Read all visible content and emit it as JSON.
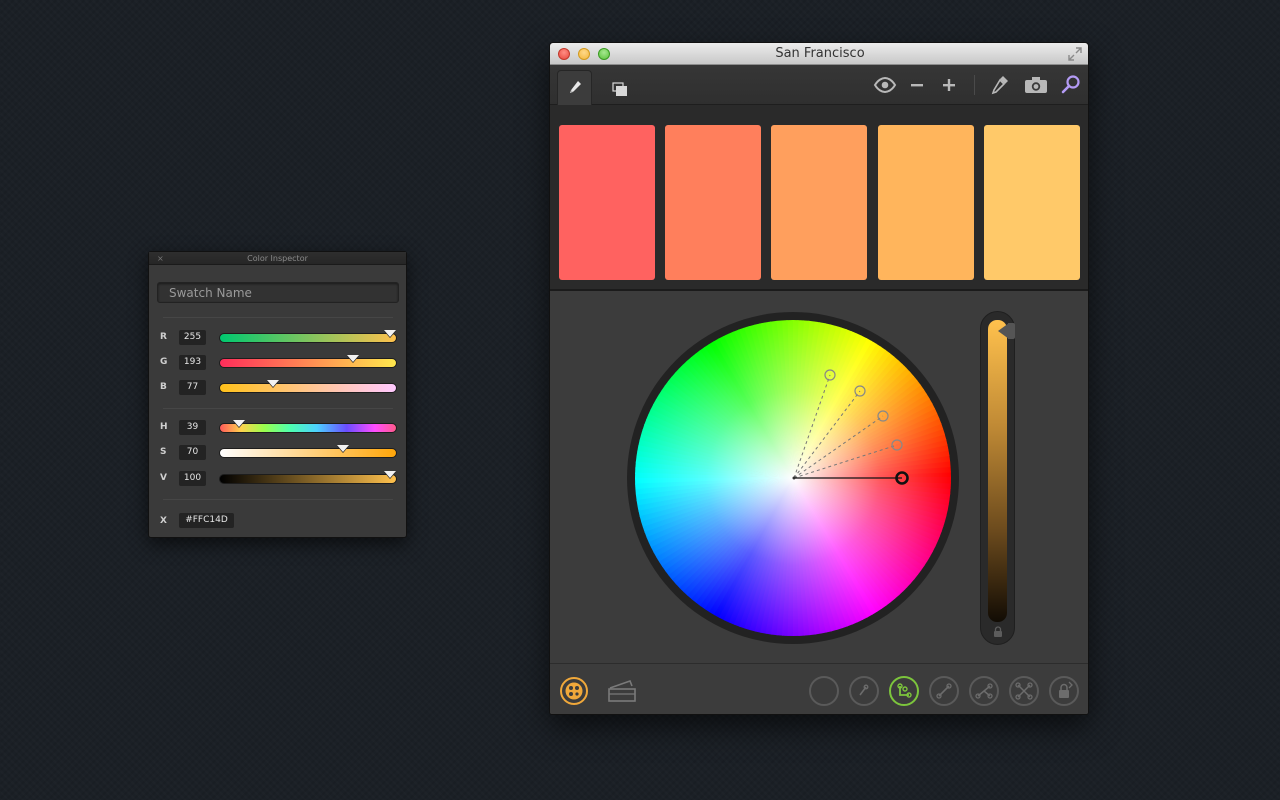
{
  "inspector": {
    "title": "Color Inspector",
    "close_label": "×",
    "swatch_name_placeholder": "Swatch Name",
    "rgb": [
      {
        "label": "R",
        "value": "255",
        "fraction": 1.0,
        "gradient": "linear-gradient(90deg, #00c870, #ffc14d)"
      },
      {
        "label": "G",
        "value": "193",
        "fraction": 0.757,
        "gradient": "linear-gradient(90deg, #ff2d5a, #ffe84d)"
      },
      {
        "label": "B",
        "value": "77",
        "fraction": 0.302,
        "gradient": "linear-gradient(90deg, #ffc11a, #ffc9ff)"
      }
    ],
    "hsv": [
      {
        "label": "H",
        "value": "39",
        "fraction": 0.108,
        "gradient": "linear-gradient(90deg, #ff5a5a, #ffd24d 12%, #9aff4d 25%, #4dffb0 40%, #4dd2ff 55%, #6a4dff 72%, #ff4dff 88%, #ff5a8a)"
      },
      {
        "label": "S",
        "value": "70",
        "fraction": 0.7,
        "gradient": "linear-gradient(90deg, #ffffff, #ffa60a)"
      },
      {
        "label": "V",
        "value": "100",
        "fraction": 1.0,
        "gradient": "linear-gradient(90deg, #000000, #ffc14d)"
      }
    ],
    "hex_label": "X",
    "hex_value": "#FFC14D"
  },
  "window": {
    "title": "San Francisco",
    "toolbar_icons": [
      "pencil-icon",
      "library-icon",
      "eye-icon",
      "minus-icon",
      "plus-icon",
      "eyedropper-icon",
      "camera-icon",
      "search-icon"
    ]
  },
  "swatches": [
    "#ff6260",
    "#ff7f5c",
    "#ff9f5d",
    "#ffb55c",
    "#ffc969"
  ],
  "wheel": {
    "base_color_hex": "#FFC14D",
    "brightness": 1.0
  },
  "bottom_bar": {
    "left_icons": [
      "color-wheel-icon",
      "color-rules-icon"
    ],
    "modes": [
      "monochromatic",
      "analogous",
      "shades",
      "complementary",
      "compound",
      "triad",
      "custom-lock"
    ],
    "active_mode": "shades",
    "accent": "#f0a83a",
    "active_mode_color": "#7cc53c"
  }
}
